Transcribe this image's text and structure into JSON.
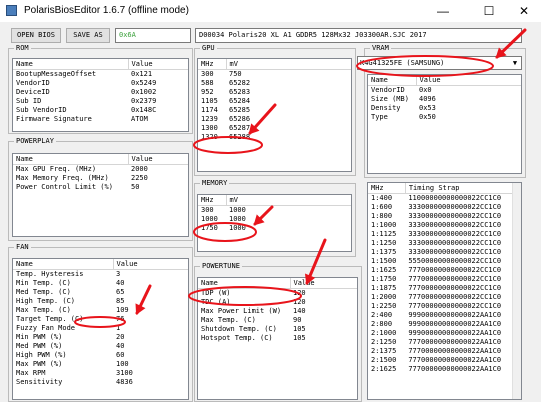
{
  "window": {
    "title": "PolarisBiosEditor 1.6.7 (offline mode)",
    "minimize": "—",
    "maximize": "☐",
    "close": "✕"
  },
  "toolbar": {
    "open_bios": "OPEN BIOS",
    "save_as": "SAVE AS",
    "checksum": "0x6A",
    "bios_string": "D00034 Polaris20 XL A1 GDDR5 128Mx32 J03300AR.SJC 2017"
  },
  "rom": {
    "title": "ROM",
    "headers": [
      "Name",
      "Value"
    ],
    "rows": [
      [
        "BootupMessageOffset",
        "0x121"
      ],
      [
        "VendorID",
        "0x5249"
      ],
      [
        "DeviceID",
        "0x1002"
      ],
      [
        "Sub ID",
        "0x2379"
      ],
      [
        "Sub VendorID",
        "0x148C"
      ],
      [
        "Firmware Signature",
        "ATOM"
      ]
    ]
  },
  "powerplay": {
    "title": "POWERPLAY",
    "headers": [
      "Name",
      "Value"
    ],
    "rows": [
      [
        "Max GPU Freq. (MHz)",
        "2000"
      ],
      [
        "Max Memory Freq. (MHz)",
        "2250"
      ],
      [
        "Power Control Limit (%)",
        "50"
      ]
    ]
  },
  "fan": {
    "title": "FAN",
    "headers": [
      "Name",
      "Value"
    ],
    "rows": [
      [
        "Temp. Hysteresis",
        "3"
      ],
      [
        "Min Temp. (C)",
        "40"
      ],
      [
        "Med Temp. (C)",
        "65"
      ],
      [
        "High Temp. (C)",
        "85"
      ],
      [
        "Max Temp. (C)",
        "109"
      ],
      [
        "Target Temp. (C)",
        "76"
      ],
      [
        "Fuzzy Fan Mode",
        "1"
      ],
      [
        "Min PWM (%)",
        "20"
      ],
      [
        "Med PWM (%)",
        "40"
      ],
      [
        "High PWM (%)",
        "60"
      ],
      [
        "Max PWM (%)",
        "100"
      ],
      [
        "Max RPM",
        "3100"
      ],
      [
        "Sensitivity",
        "4836"
      ]
    ]
  },
  "gpu": {
    "title": "GPU",
    "headers": [
      "MHz",
      "mV"
    ],
    "rows": [
      [
        "300",
        "750"
      ],
      [
        "588",
        "65282"
      ],
      [
        "952",
        "65283"
      ],
      [
        "1105",
        "65284"
      ],
      [
        "1174",
        "65285"
      ],
      [
        "1239",
        "65286"
      ],
      [
        "1300",
        "65287"
      ],
      [
        "1320",
        "65288"
      ]
    ]
  },
  "memory": {
    "title": "MEMORY",
    "headers": [
      "MHz",
      "mV"
    ],
    "rows": [
      [
        "300",
        "1000"
      ],
      [
        "1000",
        "1000"
      ],
      [
        "1750",
        "1000"
      ]
    ]
  },
  "powertune": {
    "title": "POWERTUNE",
    "headers": [
      "Name",
      "Value"
    ],
    "rows": [
      [
        "TDP (W)",
        "120"
      ],
      [
        "TDC (A)",
        "120"
      ],
      [
        "Max Power Limit (W)",
        "140"
      ],
      [
        "Max Temp. (C)",
        "90"
      ],
      [
        "Shutdown Temp. (C)",
        "105"
      ],
      [
        "Hotspot Temp. (C)",
        "105"
      ]
    ]
  },
  "vram": {
    "title": "VRAM",
    "selected": "K4G41325FE (SAMSUNG)",
    "headers": [
      "Name",
      "Value"
    ],
    "rows": [
      [
        "VendorID",
        "0x0"
      ],
      [
        "Size (MB)",
        "4096"
      ],
      [
        "Density",
        "0x53"
      ],
      [
        "Type",
        "0x50"
      ]
    ]
  },
  "timing": {
    "headers": [
      "MHz",
      "Timing Strap"
    ],
    "rows": [
      [
        "1:400",
        "11000000000000022CC1C0"
      ],
      [
        "1:600",
        "33300000000000022CC1C0"
      ],
      [
        "1:800",
        "33300000000000022CC1C0"
      ],
      [
        "1:1000",
        "33300000000000022CC1C0"
      ],
      [
        "1:1125",
        "33300000000000022CC1C0"
      ],
      [
        "1:1250",
        "33300000000000022CC1C0"
      ],
      [
        "1:1375",
        "33300000000000022CC1C0"
      ],
      [
        "1:1500",
        "55500000000000022CC1C0"
      ],
      [
        "1:1625",
        "77700000000000022CC1C0"
      ],
      [
        "1:1750",
        "77700000000000022CC1C0"
      ],
      [
        "1:1875",
        "77700000000000022CC1C0"
      ],
      [
        "1:2000",
        "77700000000000022CC1C0"
      ],
      [
        "1:2250",
        "77700000000000022CC1C0"
      ],
      [
        "2:400",
        "99900000000000022AA1C0"
      ],
      [
        "2:800",
        "99900000000000022AA1C0"
      ],
      [
        "2:1000",
        "99900000000000022AA1C0"
      ],
      [
        "2:1250",
        "77700000000000022AA1C0"
      ],
      [
        "2:1375",
        "77700000000000022AA1C0"
      ],
      [
        "2:1500",
        "77700000000000022AA1C0"
      ],
      [
        "2:1625",
        "77700000000000022AA1C0"
      ]
    ]
  },
  "annotation_color": "#e8141b"
}
